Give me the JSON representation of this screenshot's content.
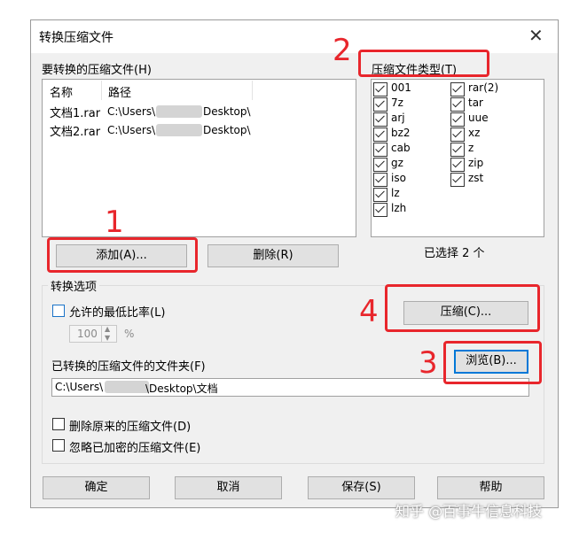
{
  "dialog": {
    "title": "转换压缩文件",
    "close_glyph": "✕"
  },
  "archives": {
    "label": "要转换的压缩文件(H)",
    "columns": [
      "名称",
      "路径"
    ],
    "rows": [
      {
        "name": "文档1.rar",
        "path_prefix": "C:\\Users\\",
        "path_suffix": "Desktop\\"
      },
      {
        "name": "文档2.rar",
        "path_prefix": "C:\\Users\\",
        "path_suffix": "Desktop\\"
      }
    ]
  },
  "types": {
    "label": "压缩文件类型(T)",
    "col1": [
      "001",
      "7z",
      "arj",
      "bz2",
      "cab",
      "gz",
      "iso",
      "lz",
      "lzh"
    ],
    "col2": [
      "rar(2)",
      "tar",
      "uue",
      "xz",
      "z",
      "zip",
      "zst"
    ],
    "all_checked": true,
    "selected_count_text": "已选择 2 个"
  },
  "buttons": {
    "add": "添加(A)...",
    "delete": "删除(R)",
    "compress": "压缩(C)...",
    "browse": "浏览(B)...",
    "ok": "确定",
    "cancel": "取消",
    "save": "保存(S)",
    "help": "帮助"
  },
  "options": {
    "group_label": "转换选项",
    "min_ratio_label": "允许的最低比率(L)",
    "min_ratio_checked": false,
    "ratio_value": "100",
    "ratio_unit": "%",
    "folder_label": "已转换的压缩文件的文件夹(F)",
    "folder_prefix": "C:\\Users\\",
    "folder_suffix": "\\Desktop\\文档",
    "delete_original_label": "删除原来的压缩文件(D)",
    "delete_original_checked": false,
    "ignore_encrypted_label": "忽略已加密的压缩文件(E)",
    "ignore_encrypted_checked": false
  },
  "annotations": {
    "m1": "1",
    "m2": "2",
    "m3": "3",
    "m4": "4",
    "color": "#e8262c"
  },
  "watermark": "知乎 @百事牛信息科技"
}
